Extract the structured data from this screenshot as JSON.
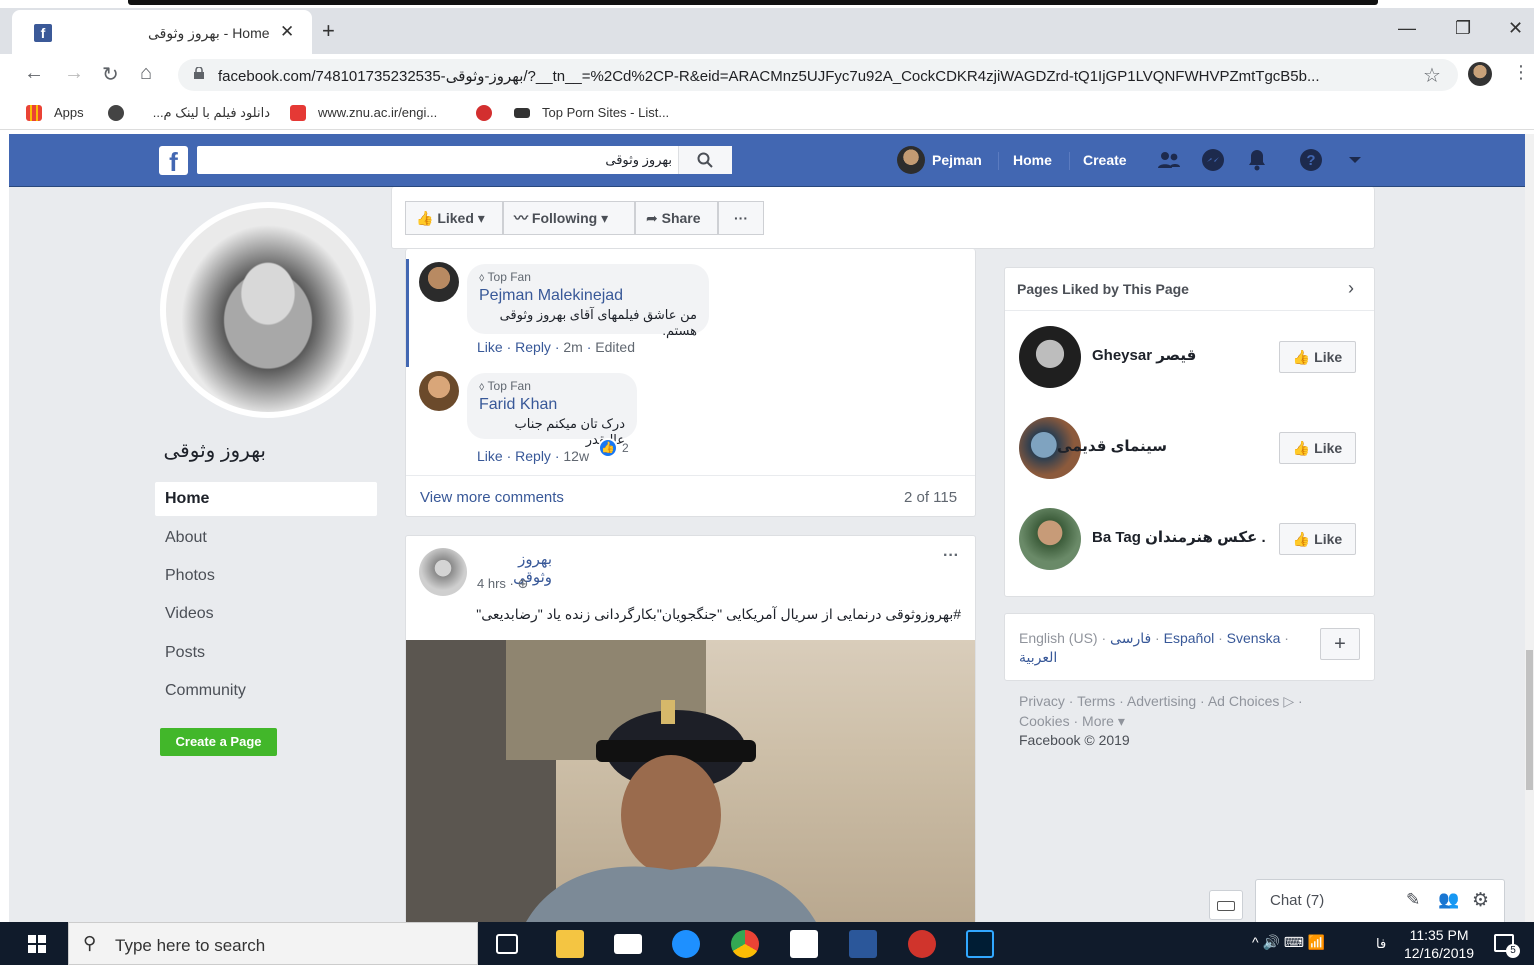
{
  "browser": {
    "tab_title": "بهروز وثوقی - Home",
    "new_tab": "+",
    "url": "facebook.com/748101735232535-بهروز-وثوقی/?__tn__=%2Cd%2CP-R&eid=ARACMnz5UJFyc7u92A_CockCDKR4zjiWAGDZrd-tQ1IjGP1LVQNFWHVPZmtTgcB5b...",
    "bookmarks": [
      {
        "label": "Apps"
      },
      {
        "label": "دانلود فیلم با لینک م..."
      },
      {
        "label": "www.znu.ac.ir/engi..."
      },
      {
        "label": "Top Porn Sites - List..."
      }
    ]
  },
  "fb": {
    "search_value": "بهروز وثوقی",
    "user_name": "Pejman",
    "nav_home": "Home",
    "nav_create": "Create"
  },
  "left": {
    "page_name": "بهروز وثوقی",
    "nav": [
      "Home",
      "About",
      "Photos",
      "Videos",
      "Posts",
      "Community"
    ],
    "create_page": "Create a Page"
  },
  "actions": {
    "liked": "Liked",
    "following": "Following",
    "share": "Share",
    "more": "···"
  },
  "comments": [
    {
      "badge": "Top Fan",
      "name": "Pejman Malekinejad",
      "text": "من عاشق فیلمهای آقای بهروز وثوقی هستم.",
      "like": "Like",
      "reply": "Reply",
      "time": "2m",
      "edited": "Edited"
    },
    {
      "badge": "Top Fan",
      "name": "Farid Khan",
      "text": "درک تان میکنم جناب عالیقدر",
      "like": "Like",
      "reply": "Reply",
      "time": "12w",
      "reactions": "2"
    }
  ],
  "view_more": "View more comments",
  "comment_count": "2 of 115",
  "post": {
    "author": "بهروز وثوقی",
    "time": "4 hrs ·",
    "text": "#بهروزوثوقی درنمایی از سریال آمریکایی \"جنگجویان\"بکارگردانی زنده یاد \"رضابدیعی\"",
    "menu": "···"
  },
  "right": {
    "pages_title": "Pages Liked by This Page",
    "pages": [
      {
        "name": "Gheysar قیصر",
        "like": "Like"
      },
      {
        "name": "سینمای قدیمی",
        "like": "Like"
      },
      {
        "name": "Ba Tag باتگ . عکس هنرمندان",
        "like": "Like"
      }
    ],
    "languages": [
      "English (US)",
      "فارسی",
      "Español",
      "Svenska",
      "العربية"
    ],
    "lang_add": "+",
    "footer_links": [
      "Privacy",
      "Terms",
      "Advertising",
      "Ad Choices",
      "Cookies",
      "More"
    ],
    "copyright": "Facebook © 2019"
  },
  "chat": {
    "label": "Chat (7)"
  },
  "taskbar": {
    "search_placeholder": "Type here to search",
    "lang": "فا",
    "time": "11:35 PM",
    "date": "12/16/2019",
    "notif_count": "5"
  },
  "colors": {
    "fb_blue": "#4267b2",
    "link": "#385898",
    "green": "#42b72a"
  }
}
